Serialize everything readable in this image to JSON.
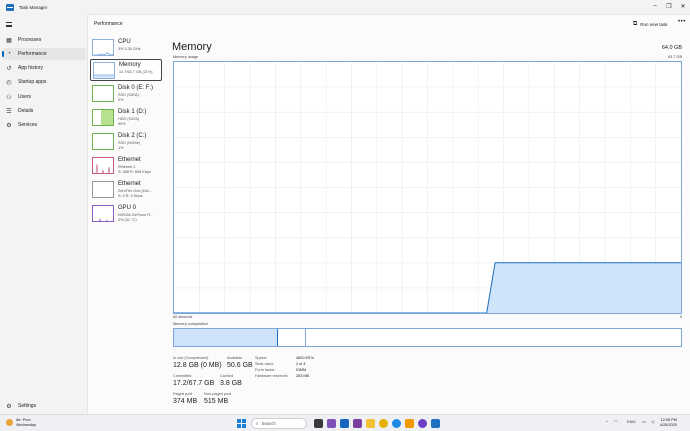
{
  "window": {
    "title": "Task Manager",
    "controls": {
      "minimize": "–",
      "maximize": "❐",
      "close": "✕"
    }
  },
  "nav": {
    "items": [
      {
        "label": "Processes",
        "icon": "processes-grid-icon",
        "glyph": "▦"
      },
      {
        "label": "Performance",
        "icon": "performance-chart-icon",
        "glyph": "◔",
        "active": true
      },
      {
        "label": "App history",
        "icon": "history-clock-icon",
        "glyph": "↺"
      },
      {
        "label": "Startup apps",
        "icon": "startup-speedometer-icon",
        "glyph": "◴"
      },
      {
        "label": "Users",
        "icon": "users-icon",
        "glyph": "⚇"
      },
      {
        "label": "Details",
        "icon": "details-list-icon",
        "glyph": "☰"
      },
      {
        "label": "Services",
        "icon": "services-gear-icon",
        "glyph": "⚙"
      }
    ],
    "settings": {
      "label": "Settings",
      "glyph": "⚙"
    }
  },
  "header": {
    "section_title": "Performance",
    "run_new_task": "Run new task",
    "more": "•••"
  },
  "devices": [
    {
      "name": "CPU",
      "sub1": "3% 3.30 GHz",
      "sub2": "",
      "color": "blue"
    },
    {
      "name": "Memory",
      "sub1": "12.7/63.7 GB (21%)",
      "sub2": "",
      "color": "blue",
      "active": true
    },
    {
      "name": "Disk 0 (E: F:)",
      "sub1": "SSD (SATA)",
      "sub2": "0%",
      "color": "green"
    },
    {
      "name": "Disk 1 (D:)",
      "sub1": "HDD (SATA)",
      "sub2": "99%",
      "color": "green"
    },
    {
      "name": "Disk 2 (C:)",
      "sub1": "SSD (NVMe)",
      "sub2": "1%",
      "color": "green"
    },
    {
      "name": "Ethernet",
      "sub1": "Ethernet 2",
      "sub2": "S: 368 R: 608 Kbps",
      "color": "pink"
    },
    {
      "name": "Ethernet",
      "sub1": "ZeroTier One [43e...",
      "sub2": "S: 0 R: 0 Kbps",
      "color": "gray"
    },
    {
      "name": "GPU 0",
      "sub1": "NVIDIA GeForce R...",
      "sub2": "2% (31 °C)",
      "color": "purple"
    }
  ],
  "memory": {
    "title": "Memory",
    "total": "64.0 GB",
    "usage_label": "Memory usage",
    "usage_max": "63.7 GB",
    "time_span": "60 seconds",
    "time_end": "0",
    "composition_label": "Memory composition",
    "usage_series_fraction": [
      0,
      0,
      0,
      0,
      0,
      0,
      0,
      0,
      0,
      0,
      0,
      0,
      0,
      0,
      0,
      0,
      0,
      0,
      0,
      0,
      0,
      0,
      0,
      0,
      0,
      0,
      0,
      0,
      0,
      0,
      0,
      0,
      0,
      0,
      0,
      0,
      0,
      0,
      0.2,
      0.2,
      0.2,
      0.2,
      0.2,
      0.2,
      0.2,
      0.2,
      0.2,
      0.2,
      0.2,
      0.2,
      0.2,
      0.2,
      0.2,
      0.2,
      0.2,
      0.2,
      0.2,
      0.2,
      0.2,
      0.2,
      0.2
    ]
  },
  "stats": {
    "in_use_label": "In use (Compressed)",
    "in_use_value": "12.8 GB (0 MB)",
    "available_label": "Available",
    "available_value": "50.6 GB",
    "committed_label": "Committed",
    "committed_value": "17.2/67.7 GB",
    "cached_label": "Cached",
    "cached_value": "3.8 GB",
    "paged_label": "Paged pool",
    "paged_value": "374 MB",
    "nonpaged_label": "Non-paged pool",
    "nonpaged_value": "515 MB"
  },
  "specs": [
    {
      "key": "Speed:",
      "value": "4800 MT/s"
    },
    {
      "key": "Slots used:",
      "value": "2 of 4"
    },
    {
      "key": "Form factor:",
      "value": "DIMM"
    },
    {
      "key": "Hardware reserved:",
      "value": "283 MB"
    }
  ],
  "taskbar": {
    "weather_temp": "Air: Poor",
    "weather_day": "Wednesday",
    "search_placeholder": "Search",
    "tray_lang": "ENG",
    "time": "12:05 PM",
    "date": "4/28/2025"
  },
  "colors": {
    "accent": "#0067c0",
    "memory_line": "#1a6fc2",
    "memory_fill": "#cfe3fa"
  }
}
